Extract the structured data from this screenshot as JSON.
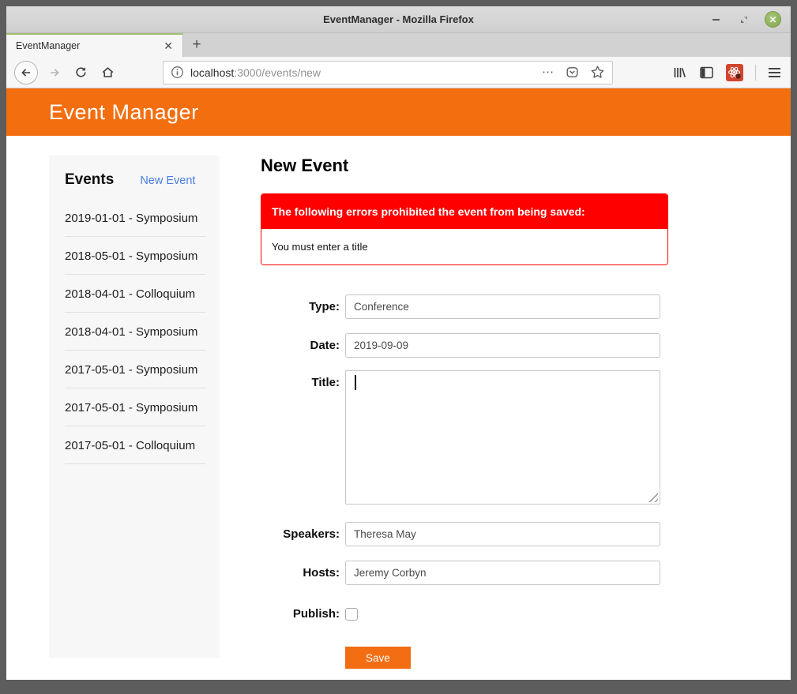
{
  "window": {
    "title": "EventManager - Mozilla Firefox",
    "controls": {
      "close_glyph": "✕"
    }
  },
  "browser": {
    "tab_title": "EventManager",
    "tab_close_glyph": "✕",
    "new_tab_glyph": "+",
    "url_host": "localhost",
    "url_path": ":3000/events/new",
    "page_actions_glyph": "⋯",
    "icons": {
      "back": "back-arrow",
      "forward": "forward-arrow",
      "reload": "reload-arrow",
      "home": "house",
      "identity": "info-circle",
      "pocket": "pocket-shield",
      "bookmark": "star",
      "library": "library-books",
      "sidebars": "sidebar-panel",
      "extension": "react-devtools-red",
      "menu": "hamburger"
    }
  },
  "app": {
    "header_title": "Event Manager",
    "sidebar": {
      "heading": "Events",
      "new_event_link": "New Event",
      "events": [
        "2019-01-01 - Symposium",
        "2018-05-01 - Symposium",
        "2018-04-01 - Colloquium",
        "2018-04-01 - Symposium",
        "2017-05-01 - Symposium",
        "2017-05-01 - Symposium",
        "2017-05-01 - Colloquium"
      ]
    },
    "main": {
      "title": "New Event",
      "error": {
        "header": "The following errors prohibited the event from being saved:",
        "messages": [
          "You must enter a title"
        ]
      },
      "form": {
        "fields": [
          {
            "label": "Type:",
            "value": "Conference"
          },
          {
            "label": "Date:",
            "value": "2019-09-09"
          },
          {
            "label": "Title:",
            "value": ""
          },
          {
            "label": "Speakers:",
            "value": "Theresa May"
          },
          {
            "label": "Hosts:",
            "value": "Jeremy Corbyn"
          },
          {
            "label": "Publish:",
            "checked": false
          }
        ],
        "save_label": "Save"
      }
    }
  },
  "colors": {
    "accent_orange": "#f36e0f",
    "save_orange": "#f36d12",
    "error_red": "#fe0000",
    "link_blue": "#4a7de0",
    "tab_green": "#9cbe70",
    "window_border_gray": "#5d5d5d"
  }
}
